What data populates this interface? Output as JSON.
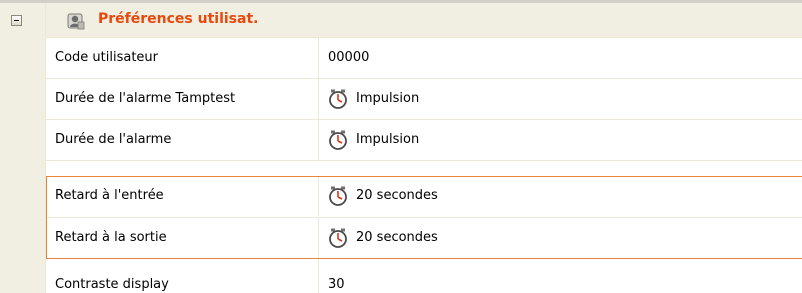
{
  "category": {
    "label": "Préférences utilisat.",
    "icon": "user-icon",
    "expanded": true,
    "label_color": "#e8480c"
  },
  "rows": [
    {
      "name": "Code utilisateur",
      "value": "00000",
      "icon": null
    },
    {
      "name": "Durée de l'alarme Tamptest",
      "value": "Impulsion",
      "icon": "timer-icon"
    },
    {
      "name": "Durée de l'alarme",
      "value": "Impulsion",
      "icon": "timer-icon"
    },
    {
      "name": "Retard à l'entrée",
      "value": "20 secondes",
      "icon": "timer-icon"
    },
    {
      "name": "Retard à la sortie",
      "value": "20 secondes",
      "icon": "timer-icon"
    },
    {
      "name": "Contraste display",
      "value": "30",
      "icon": null
    }
  ],
  "colors": {
    "highlight_border": "#e8843a",
    "gutter": "#f1efe2",
    "gridline": "#ece9d8"
  }
}
